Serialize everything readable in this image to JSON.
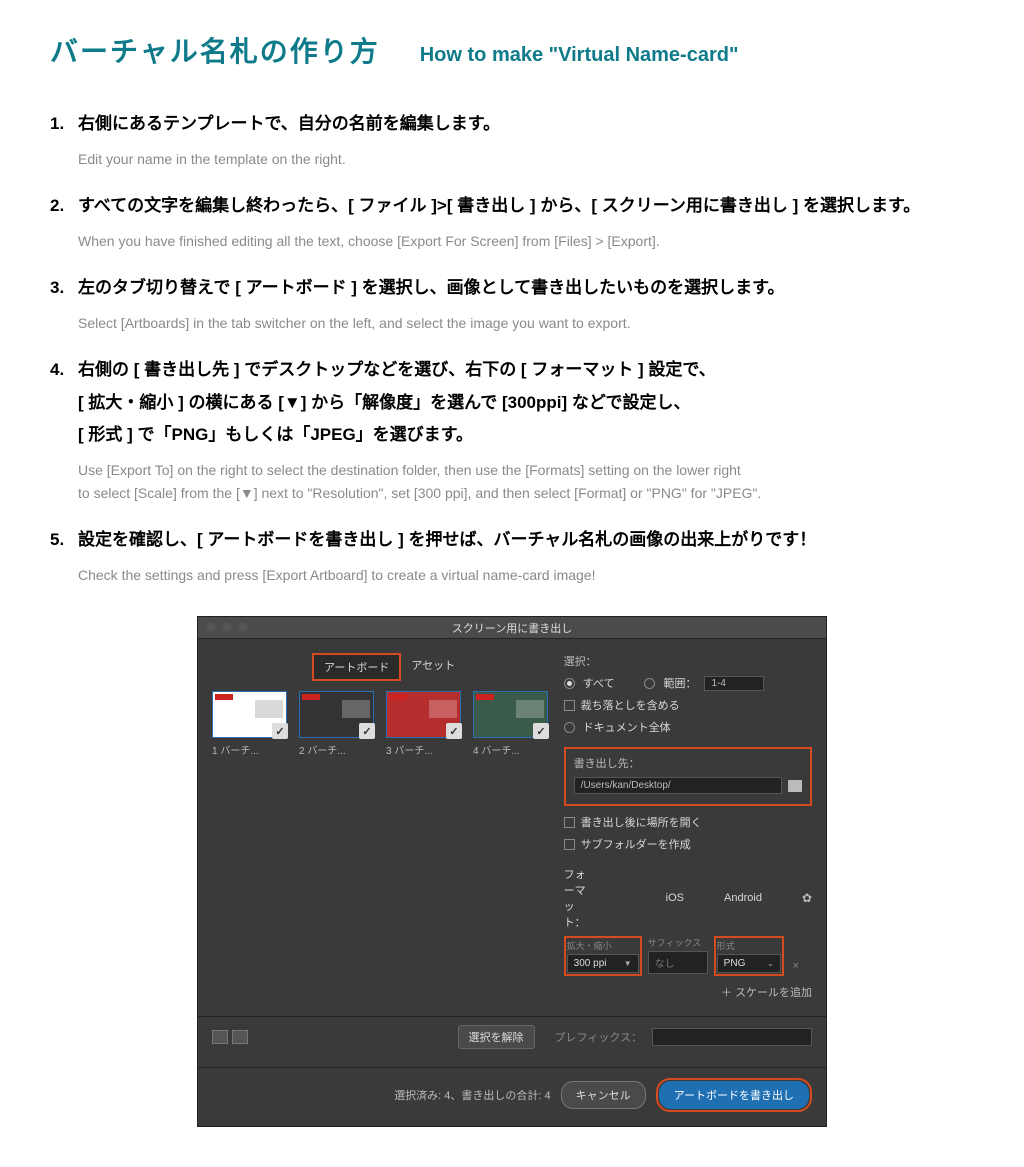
{
  "title": {
    "ja": "バーチャル名札の作り方",
    "en": "How to make \"Virtual Name-card\""
  },
  "steps": [
    {
      "num": "1.",
      "ja": [
        "右側にあるテンプレートで、自分の名前を編集します。"
      ],
      "en": [
        "Edit your name in the template on the right."
      ]
    },
    {
      "num": "2.",
      "ja": [
        "すべての文字を編集し終わったら、[ ファイル ]>[ 書き出し ] から、[ スクリーン用に書き出し ] を選択します。"
      ],
      "en": [
        "When you have finished editing all the text, choose [Export For Screen] from [Files] > [Export]."
      ]
    },
    {
      "num": "3.",
      "ja": [
        "左のタブ切り替えで [ アートボード ] を選択し、画像として書き出したいものを選択します。"
      ],
      "en": [
        "Select [Artboards] in the tab switcher on the left, and select the image you want to export."
      ]
    },
    {
      "num": "4.",
      "ja": [
        "右側の [ 書き出し先 ] でデスクトップなどを選び、右下の [ フォーマット ] 設定で、",
        "[ 拡大・縮小 ] の横にある [▼] から「解像度」を選んで [300ppi] などで設定し、",
        "[ 形式 ] で「PNG」もしくは「JPEG」を選びます。"
      ],
      "en": [
        "Use [Export To] on the right to select the destination folder, then use the [Formats] setting on the lower right",
        "to select [Scale] from the [▼] next to \"Resolution\", set [300 ppi], and then select [Format] or \"PNG\" for \"JPEG\"."
      ]
    },
    {
      "num": "5.",
      "ja": [
        "設定を確認し、[ アートボードを書き出し ] を押せば、バーチャル名札の画像の出来上がりです！"
      ],
      "en": [
        "Check the settings and press [Export Artboard] to create a virtual name-card image!"
      ]
    }
  ],
  "dialog": {
    "windowTitle": "スクリーン用に書き出し",
    "tabs": {
      "artboards": "アートボード",
      "assets": "アセット"
    },
    "artboards": [
      {
        "idx": "1",
        "label": "バーチ..."
      },
      {
        "idx": "2",
        "label": "バーチ..."
      },
      {
        "idx": "3",
        "label": "バーチ..."
      },
      {
        "idx": "4",
        "label": "バーチ..."
      }
    ],
    "select": {
      "label": "選択：",
      "all": "すべて",
      "range": "範囲：",
      "rangeValue": "1-4",
      "includeBleed": "裁ち落としを含める",
      "fullDocument": "ドキュメント全体"
    },
    "exportTo": {
      "label": "書き出し先：",
      "path": "/Users/kan/Desktop/",
      "openAfter": "書き出し後に場所を開く",
      "createSub": "サブフォルダーを作成"
    },
    "formats": {
      "label": "フォーマット：",
      "ios": "iOS",
      "android": "Android",
      "colScale": "拡大・縮小",
      "colSuffix": "サフィックス",
      "colFormat": "形式",
      "scaleValue": "300 ppi",
      "suffixValue": "なし",
      "formatValue": "PNG",
      "addScale": "＋ スケールを追加"
    },
    "deselect": "選択を解除",
    "prefixLabel": "プレフィックス：",
    "status": "選択済み: 4、書き出しの合計: 4",
    "cancel": "キャンセル",
    "export": "アートボードを書き出し"
  }
}
